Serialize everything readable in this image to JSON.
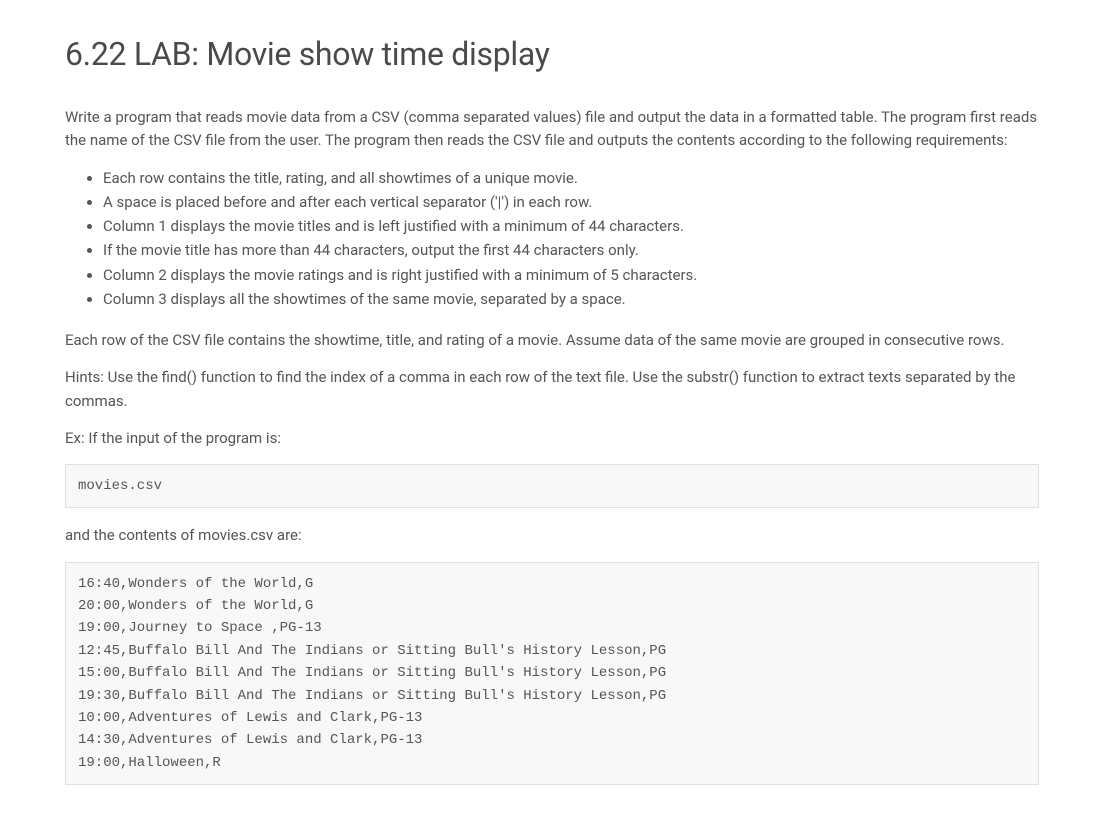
{
  "heading": "6.22 LAB: Movie show time display",
  "intro": "Write a program that reads movie data from a CSV (comma separated values) file and output the data in a formatted table. The program first reads the name of the CSV file from the user. The program then reads the CSV file and outputs the contents according to the following requirements:",
  "bullets": [
    "Each row contains the title, rating, and all showtimes of a unique movie.",
    "A space is placed before and after each vertical separator ('|') in each row.",
    "Column 1 displays the movie titles and is left justified with a minimum of 44 characters.",
    "If the movie title has more than 44 characters, output the first 44 characters only.",
    "Column 2 displays the movie ratings and is right justified with a minimum of 5 characters.",
    "Column 3 displays all the showtimes of the same movie, separated by a space."
  ],
  "csv_note": "Each row of the CSV file contains the showtime, title, and rating of a movie. Assume data of the same movie are grouped in consecutive rows.",
  "hints": "Hints: Use the find() function to find the index of a comma in each row of the text file. Use the substr() function to extract texts separated by the commas.",
  "example_label": "Ex: If the input of the program is:",
  "input_filename": "movies.csv",
  "contents_label": "and the contents of movies.csv are:",
  "csv_contents": "16:40,Wonders of the World,G\n20:00,Wonders of the World,G\n19:00,Journey to Space ,PG-13\n12:45,Buffalo Bill And The Indians or Sitting Bull's History Lesson,PG\n15:00,Buffalo Bill And The Indians or Sitting Bull's History Lesson,PG\n19:30,Buffalo Bill And The Indians or Sitting Bull's History Lesson,PG\n10:00,Adventures of Lewis and Clark,PG-13\n14:30,Adventures of Lewis and Clark,PG-13\n19:00,Halloween,R"
}
